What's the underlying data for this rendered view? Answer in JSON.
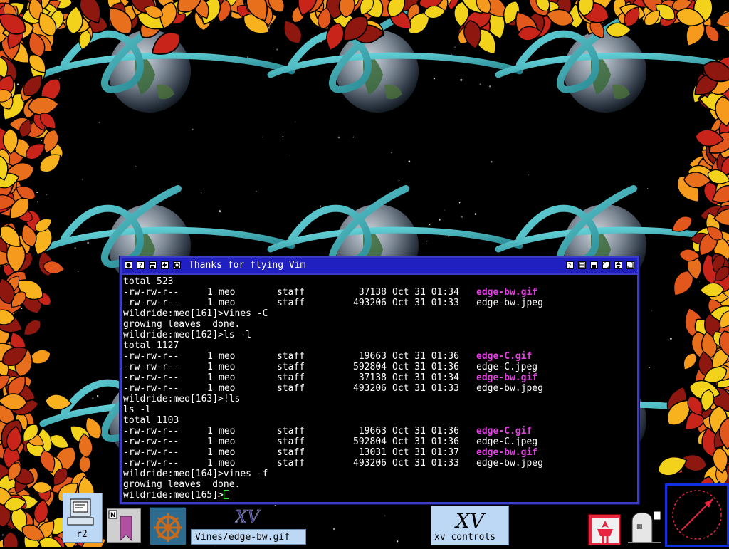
{
  "window": {
    "title": "Thanks for flying Vim",
    "lines": [
      {
        "type": "text",
        "text": "total 523"
      },
      {
        "type": "file",
        "perm": "-rw-rw-r--",
        "links": "1",
        "owner": "meo",
        "group": "staff",
        "size": "37138",
        "date": "Oct 31 01:34",
        "name": "edge-bw.gif",
        "gif": true
      },
      {
        "type": "file",
        "perm": "-rw-rw-r--",
        "links": "1",
        "owner": "meo",
        "group": "staff",
        "size": "493206",
        "date": "Oct 31 01:33",
        "name": "edge-bw.jpeg",
        "gif": false
      },
      {
        "type": "text",
        "text": "wildride:meo[161]>vines -C"
      },
      {
        "type": "text",
        "text": "growing leaves  done."
      },
      {
        "type": "text",
        "text": "wildride:meo[162]>ls -l"
      },
      {
        "type": "text",
        "text": "total 1127"
      },
      {
        "type": "file",
        "perm": "-rw-rw-r--",
        "links": "1",
        "owner": "meo",
        "group": "staff",
        "size": "19663",
        "date": "Oct 31 01:36",
        "name": "edge-C.gif",
        "gif": true
      },
      {
        "type": "file",
        "perm": "-rw-rw-r--",
        "links": "1",
        "owner": "meo",
        "group": "staff",
        "size": "592804",
        "date": "Oct 31 01:36",
        "name": "edge-C.jpeg",
        "gif": false
      },
      {
        "type": "file",
        "perm": "-rw-rw-r--",
        "links": "1",
        "owner": "meo",
        "group": "staff",
        "size": "37138",
        "date": "Oct 31 01:34",
        "name": "edge-bw.gif",
        "gif": true
      },
      {
        "type": "file",
        "perm": "-rw-rw-r--",
        "links": "1",
        "owner": "meo",
        "group": "staff",
        "size": "493206",
        "date": "Oct 31 01:33",
        "name": "edge-bw.jpeg",
        "gif": false
      },
      {
        "type": "text",
        "text": "wildride:meo[163]>!ls"
      },
      {
        "type": "text",
        "text": "ls -l"
      },
      {
        "type": "text",
        "text": "total 1103"
      },
      {
        "type": "file",
        "perm": "-rw-rw-r--",
        "links": "1",
        "owner": "meo",
        "group": "staff",
        "size": "19663",
        "date": "Oct 31 01:36",
        "name": "edge-C.gif",
        "gif": true
      },
      {
        "type": "file",
        "perm": "-rw-rw-r--",
        "links": "1",
        "owner": "meo",
        "group": "staff",
        "size": "592804",
        "date": "Oct 31 01:36",
        "name": "edge-C.jpeg",
        "gif": false
      },
      {
        "type": "file",
        "perm": "-rw-rw-r--",
        "links": "1",
        "owner": "meo",
        "group": "staff",
        "size": "13031",
        "date": "Oct 31 01:37",
        "name": "edge-bw.gif",
        "gif": true
      },
      {
        "type": "file",
        "perm": "-rw-rw-r--",
        "links": "1",
        "owner": "meo",
        "group": "staff",
        "size": "493206",
        "date": "Oct 31 01:33",
        "name": "edge-bw.jpeg",
        "gif": false
      },
      {
        "type": "text",
        "text": "wildride:meo[164]>vines -f"
      },
      {
        "type": "text",
        "text": "growing leaves  done."
      },
      {
        "type": "prompt",
        "text": "wildride:meo[165]>"
      }
    ]
  },
  "dock": {
    "r2_label": "r2",
    "vines_label": "Vines/edge-bw.gif",
    "xv_controls_label": "xv controls",
    "xv_logo": "XV",
    "n_badge": "N"
  },
  "colors": {
    "gif_name": "#e040e0",
    "window_frame": "#3c3cc8",
    "titlebar": "#2020c0",
    "cursor": "#2ef02e"
  },
  "icons": {
    "window_buttons_left": [
      "close-icon",
      "help-icon",
      "save-icon",
      "lightning-icon",
      "gear-icon"
    ],
    "window_buttons_right": [
      "question-box-icon",
      "window-list-icon",
      "iconify-icon",
      "resize-icon",
      "raise-lower-icon",
      "maximize-icon"
    ]
  }
}
